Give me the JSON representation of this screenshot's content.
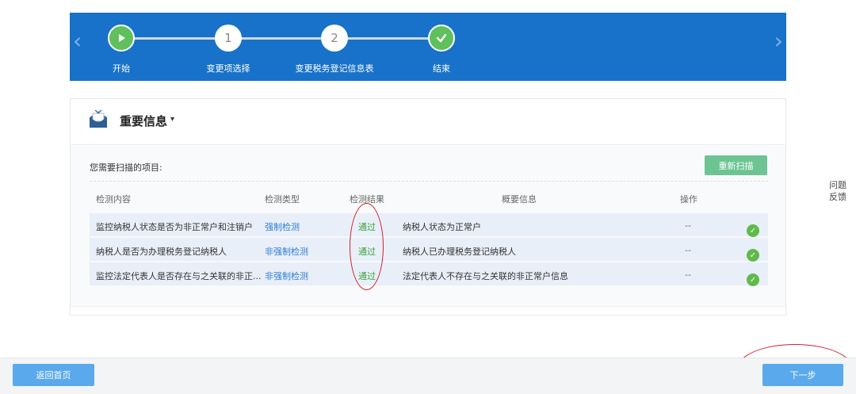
{
  "steps": [
    {
      "label": "开始",
      "marker": "play-icon",
      "status": "done"
    },
    {
      "label": "变更项选择",
      "marker": "1",
      "status": "done"
    },
    {
      "label": "变更税务登记信息表",
      "marker": "2",
      "status": "done"
    },
    {
      "label": "结束",
      "marker": "check-icon",
      "status": "current"
    }
  ],
  "card": {
    "title": "重要信息",
    "caret": "▾",
    "scan_label": "您需要扫描的项目:",
    "rescan_label": "重新扫描"
  },
  "table": {
    "headers": [
      "检测内容",
      "检测类型",
      "检测结果",
      "概要信息",
      "操作"
    ],
    "rows": [
      {
        "content": "监控纳税人状态是否为非正常户和注销户",
        "type": "强制检测",
        "result": "通过",
        "summary": "纳税人状态为正常户",
        "op": "--"
      },
      {
        "content": "纳税人是否为办理税务登记纳税人",
        "type": "非强制检测",
        "result": "通过",
        "summary": "纳税人已办理税务登记纳税人",
        "op": "--"
      },
      {
        "content": "监控法定代表人是否存在与之关联的非正...",
        "type": "非强制检测",
        "result": "通过",
        "summary": "法定代表人不存在与之关联的非正常户信息",
        "op": "--"
      }
    ]
  },
  "feedback": "问题反馈",
  "bottom": {
    "home_label": "返回首页",
    "next_label": "下一步"
  },
  "colors": {
    "stepbar": "#1872c9",
    "step_done": "#5fc05c",
    "rescan": "#6cc493",
    "button": "#5aa9ec",
    "annotation": "#d0202a"
  }
}
